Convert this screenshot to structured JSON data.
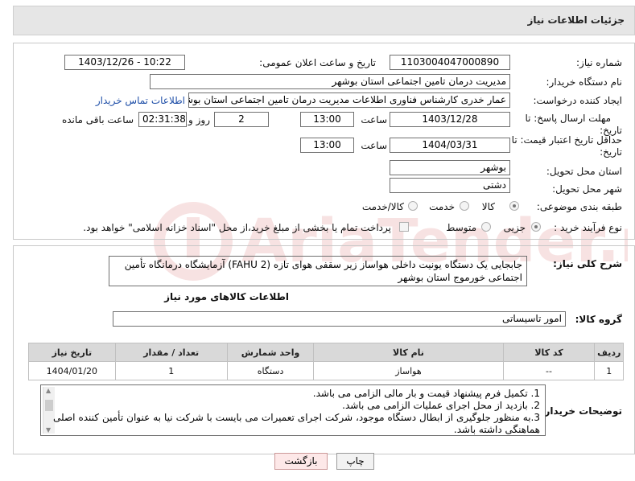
{
  "header": {
    "title": "جزئیات اطلاعات نیاز"
  },
  "fields": {
    "need_number_label": "شماره نیاز:",
    "need_number": "1103004047000890",
    "announce_label": "تاریخ و ساعت اعلان عمومی:",
    "announce_value": "1403/12/26 - 10:22",
    "buyer_label": "نام دستگاه خریدار:",
    "buyer_value": "مدیریت درمان تامین اجتماعی استان بوشهر",
    "creator_label": "ایجاد کننده درخواست:",
    "creator_value": "عمار خدری کارشناس فناوری اطلاعات مدیریت درمان تامین اجتماعی استان بوشهر",
    "contact_link": "اطلاعات تماس خریدار",
    "deadline_label_1": "مهلت ارسال پاسخ: تا",
    "deadline_label_2": "تاریخ:",
    "deadline_date": "1403/12/28",
    "time_label": "ساعت",
    "deadline_time": "13:00",
    "days_value": "2",
    "days_label": "روز و",
    "remaining_value": "02:31:38",
    "remaining_label": "ساعت باقی مانده",
    "validity_label_1": "حداقل تاریخ اعتبار قیمت: تا",
    "validity_label_2": "تاریخ:",
    "validity_date": "1404/03/31",
    "validity_time": "13:00",
    "province_label": "استان محل تحویل:",
    "province_value": "بوشهر",
    "city_label": "شهر محل تحویل:",
    "city_value": "دشتی",
    "category_label": "طبقه بندی موضوعی:",
    "category_options": [
      "کالا",
      "خدمت",
      "کالا/خدمت"
    ],
    "process_label": "نوع فرآیند خرید :",
    "process_options": [
      "جزیی",
      "متوسط"
    ],
    "payment_note": "پرداخت تمام یا بخشی از مبلغ خرید،از محل \"اسناد خزانه اسلامی\" خواهد بود."
  },
  "description": {
    "label": "شرح کلی نیاز:",
    "text": "جابجایی یک دستگاه یونیت داخلی هواساز زیر سقفی هوای تازه (FAHU 2) آزمایشگاه درمانگاه تأمین اجتماعی خورموج استان بوشهر"
  },
  "goods": {
    "section_title": "اطلاعات کالاهای مورد نیاز",
    "group_label": "گروه کالا:",
    "group_value": "امور تاسیساتی",
    "columns": [
      "ردیف",
      "کد کالا",
      "نام کالا",
      "واحد شمارش",
      "تعداد / مقدار",
      "تاریخ نیاز"
    ],
    "rows": [
      [
        "1",
        "--",
        "هواساز",
        "دستگاه",
        "1",
        "1404/01/20"
      ]
    ]
  },
  "notes": {
    "label": "توضیحات خریدار:",
    "lines": [
      "1. تکمیل فرم پیشنهاد قیمت و بار مالی الزامی می باشد.",
      "2. بازدید از محل اجرای عملیات الزامی می باشد.",
      "3.به منظور جلوگیری از ابطال دستگاه موجود، شرکت اجرای تعمیرات می بایست با شرکت نیا به عنوان تأمین کننده اصلی هماهنگی داشته باشد."
    ]
  },
  "buttons": {
    "print": "چاپ",
    "back": "بازگشت"
  },
  "watermark": {
    "text": "AriaTender.net"
  }
}
